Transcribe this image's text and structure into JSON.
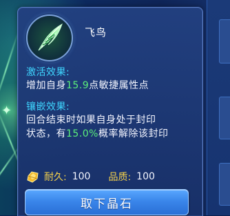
{
  "item": {
    "name": "飞鸟",
    "icon": "green-feather-icon"
  },
  "activation": {
    "title": "激活效果:",
    "line1_prefix": "增加自身",
    "line1_value": "15.9",
    "line1_suffix": "点敏捷属性点"
  },
  "inlay": {
    "title": "镶嵌效果:",
    "line1": "回合结束时如果自身处于封印",
    "line2_prefix": "状态，有",
    "line2_value": "15.0%",
    "line2_suffix": "概率解除该封印"
  },
  "stats": {
    "icon": "gold-gem-icon",
    "durability_label": "耐久:",
    "durability_value": "100",
    "quality_label": "品质:",
    "quality_value": "100"
  },
  "actions": {
    "remove_label": "取下晶石"
  },
  "colors": {
    "section_title": "#3fd6ff",
    "highlight": "#5cf07a",
    "stat_label": "#f6d24a",
    "button": "#3a86ea"
  }
}
